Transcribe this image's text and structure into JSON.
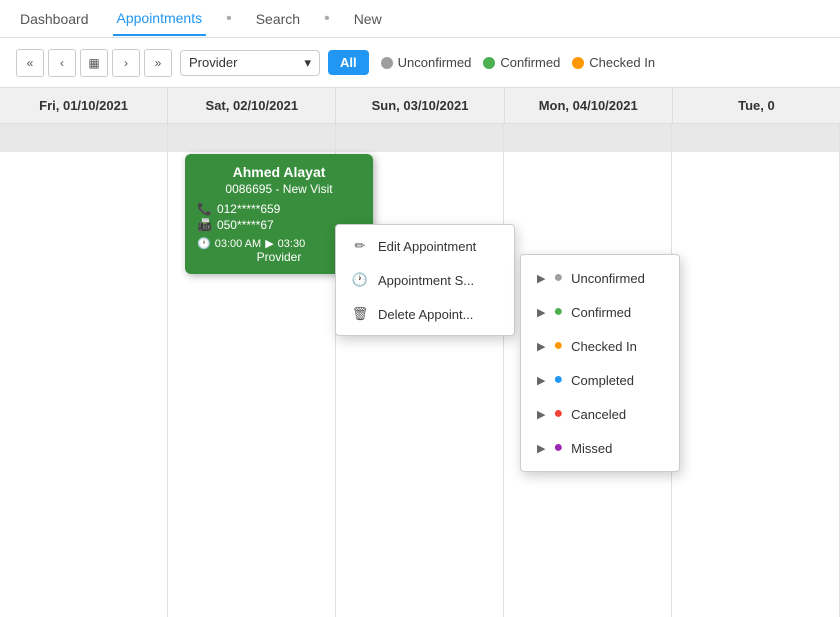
{
  "nav": {
    "dashboard_label": "Dashboard",
    "appointments_label": "Appointments",
    "search_label": "Search",
    "new_label": "New",
    "separator": "•"
  },
  "toolbar": {
    "provider_placeholder": "Provider",
    "all_btn": "All",
    "status_unconfirmed": "Unconfirmed",
    "status_confirmed": "Confirmed",
    "status_checkedin": "Checked In",
    "dot_unconfirmed_color": "#9E9E9E",
    "dot_confirmed_color": "#4CAF50",
    "dot_checkedin_color": "#FF9800"
  },
  "dates": [
    "Fri, 01/10/2021",
    "Sat, 02/10/2021",
    "Sun, 03/10/2021",
    "Mon, 04/10/2021",
    "Tue, 0"
  ],
  "appointment": {
    "name": "Ahmed Alayat",
    "id_visit": "0086695 - New Visit",
    "phone1": "012*****659",
    "phone2": "050*****67",
    "time_start": "03:00 AM",
    "arrow": "▶",
    "time_end": "03:30",
    "provider": "Provider"
  },
  "context_menu": {
    "edit_label": "Edit Appointment",
    "status_label": "Appointment S...",
    "delete_label": "Delete Appoint..."
  },
  "status_submenu": {
    "items": [
      {
        "label": "Unconfirmed",
        "color_class": "sm-dot-unconfirmed"
      },
      {
        "label": "Confirmed",
        "color_class": "sm-dot-confirmed"
      },
      {
        "label": "Checked In",
        "color_class": "sm-dot-checkedin"
      },
      {
        "label": "Completed",
        "color_class": "sm-dot-completed"
      },
      {
        "label": "Canceled",
        "color_class": "sm-dot-canceled"
      },
      {
        "label": "Missed",
        "color_class": "sm-dot-missed"
      }
    ]
  },
  "icons": {
    "double_left": "«",
    "left": "‹",
    "calendar": "▦",
    "right": "›",
    "double_right": "»",
    "chevron_down": "▾",
    "phone": "📞",
    "fax": "📠",
    "clock": "🕐",
    "edit": "✏",
    "status_icon": "🕐",
    "delete": "🗑",
    "arrow_right": "▶"
  }
}
